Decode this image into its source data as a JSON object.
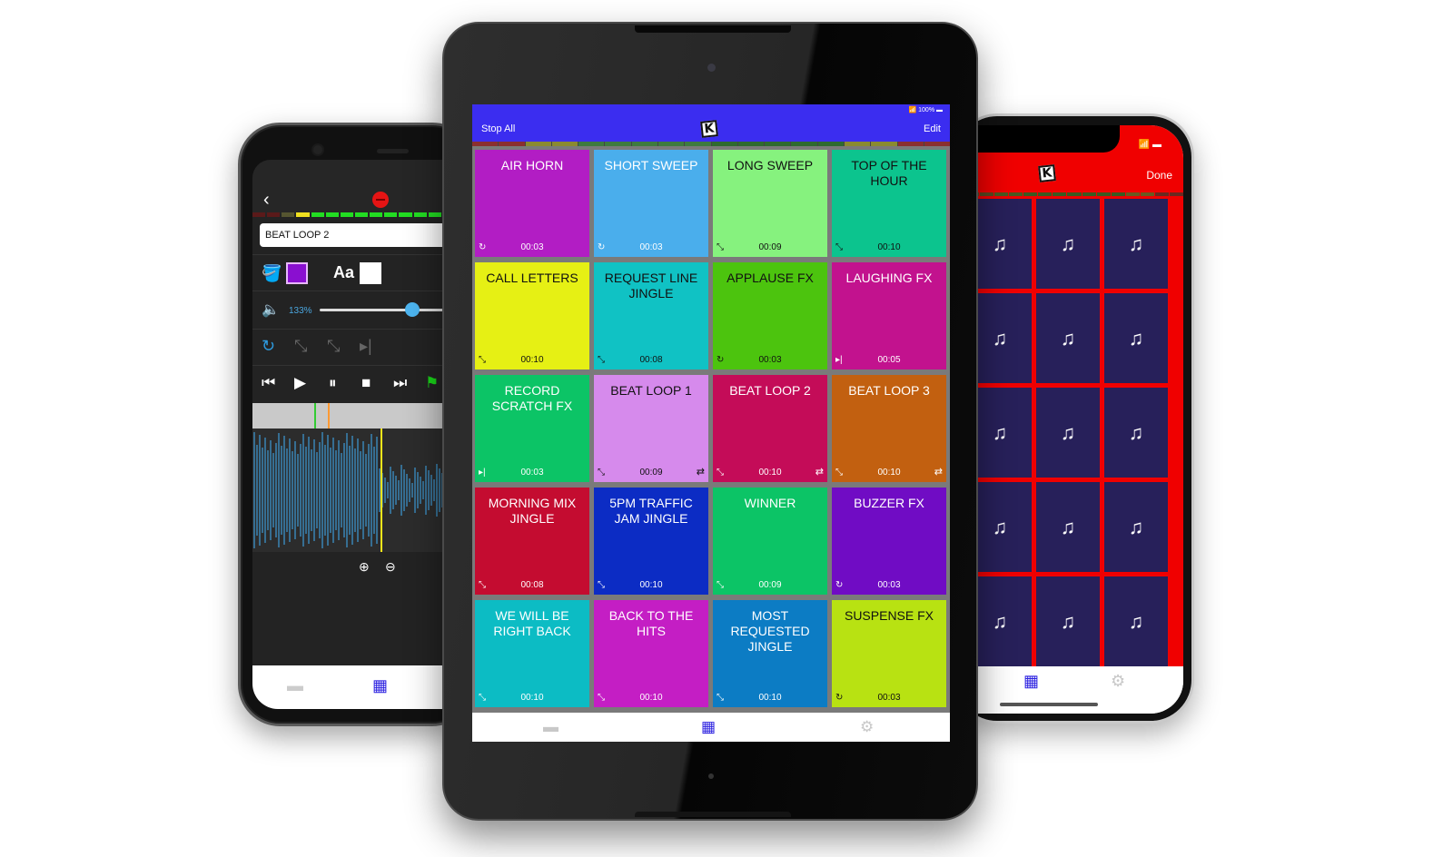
{
  "tablet": {
    "status_bar": {
      "wifi_icon": "wifi-icon",
      "battery_text": "100%"
    },
    "header": {
      "left_button": "Stop All",
      "right_button": "Edit",
      "logo_letter": "K",
      "background": "#3b2df0"
    },
    "level_meter_colors": [
      "#8a2f2f",
      "#8a2f2f",
      "#8a8a30",
      "#8a8a30",
      "#3e7a3e",
      "#3e7a3e",
      "#3e7a3e",
      "#3e7a3e",
      "#3e7a3e",
      "#2f6a2f",
      "#2f6a2f",
      "#2f6a2f",
      "#2f6a2f",
      "#2f6a2f",
      "#8a8a30",
      "#8a8a30",
      "#8a2f2f",
      "#8a2f2f"
    ],
    "pads": [
      {
        "title": "AIR HORN",
        "time": "00:03",
        "mode_icon": "restart-icon",
        "mode_glyph": "↻",
        "loop": false,
        "bg": "#b21dc4",
        "fg": "#ffffff"
      },
      {
        "title": "SHORT SWEEP",
        "time": "00:03",
        "mode_icon": "restart-icon",
        "mode_glyph": "↻",
        "loop": false,
        "bg": "#4aaeec",
        "fg": "#ffffff"
      },
      {
        "title": "LONG SWEEP",
        "time": "00:09",
        "mode_icon": "fade-icon",
        "mode_glyph": "⤡",
        "loop": false,
        "bg": "#86f27e",
        "fg": "#111111"
      },
      {
        "title": "TOP OF THE HOUR",
        "time": "00:10",
        "mode_icon": "fade-icon",
        "mode_glyph": "⤡",
        "loop": false,
        "bg": "#0cc48e",
        "fg": "#111111"
      },
      {
        "title": "CALL LETTERS",
        "time": "00:10",
        "mode_icon": "fade-icon",
        "mode_glyph": "⤡",
        "loop": false,
        "bg": "#e6f014",
        "fg": "#111111"
      },
      {
        "title": "REQUEST LINE JINGLE",
        "time": "00:08",
        "mode_icon": "fade-icon",
        "mode_glyph": "⤡",
        "loop": false,
        "bg": "#10c2c4",
        "fg": "#111111"
      },
      {
        "title": "APPLAUSE FX",
        "time": "00:03",
        "mode_icon": "restart-icon",
        "mode_glyph": "↻",
        "loop": false,
        "bg": "#4cc40e",
        "fg": "#111111"
      },
      {
        "title": "LAUGHING FX",
        "time": "00:05",
        "mode_icon": "play-to-end-icon",
        "mode_glyph": "▸|",
        "loop": false,
        "bg": "#c2128e",
        "fg": "#ffffff"
      },
      {
        "title": "RECORD SCRATCH FX",
        "time": "00:03",
        "mode_icon": "play-to-end-icon",
        "mode_glyph": "▸|",
        "loop": false,
        "bg": "#0cc466",
        "fg": "#ffffff"
      },
      {
        "title": "BEAT LOOP 1",
        "time": "00:09",
        "mode_icon": "fade-stop-icon",
        "mode_glyph": "⤡",
        "loop": true,
        "bg": "#d68aec",
        "fg": "#111111"
      },
      {
        "title": "BEAT LOOP 2",
        "time": "00:10",
        "mode_icon": "fade-stop-icon",
        "mode_glyph": "⤡",
        "loop": true,
        "bg": "#c40c58",
        "fg": "#ffffff"
      },
      {
        "title": "BEAT LOOP 3",
        "time": "00:10",
        "mode_icon": "fade-stop-icon",
        "mode_glyph": "⤡",
        "loop": true,
        "bg": "#c26010",
        "fg": "#ffffff"
      },
      {
        "title": "MORNING MIX JINGLE",
        "time": "00:08",
        "mode_icon": "fade-icon",
        "mode_glyph": "⤡",
        "loop": false,
        "bg": "#c40c30",
        "fg": "#ffffff"
      },
      {
        "title": "5PM TRAFFIC JAM JINGLE",
        "time": "00:10",
        "mode_icon": "fade-stop-icon",
        "mode_glyph": "⤡",
        "loop": false,
        "bg": "#0c2cc4",
        "fg": "#ffffff"
      },
      {
        "title": "WINNER",
        "time": "00:09",
        "mode_icon": "fade-icon",
        "mode_glyph": "⤡",
        "loop": false,
        "bg": "#0cc466",
        "fg": "#ffffff"
      },
      {
        "title": "BUZZER FX",
        "time": "00:03",
        "mode_icon": "restart-icon",
        "mode_glyph": "↻",
        "loop": false,
        "bg": "#700cc4",
        "fg": "#ffffff"
      },
      {
        "title": "WE WILL BE RIGHT BACK",
        "time": "00:10",
        "mode_icon": "fade-icon",
        "mode_glyph": "⤡",
        "loop": false,
        "bg": "#0cbcc4",
        "fg": "#ffffff"
      },
      {
        "title": "BACK TO THE HITS",
        "time": "00:10",
        "mode_icon": "fade-icon",
        "mode_glyph": "⤡",
        "loop": false,
        "bg": "#c41ec4",
        "fg": "#ffffff"
      },
      {
        "title": "MOST REQUESTED JINGLE",
        "time": "00:10",
        "mode_icon": "fade-icon",
        "mode_glyph": "⤡",
        "loop": false,
        "bg": "#0c7cc4",
        "fg": "#ffffff"
      },
      {
        "title": "SUSPENSE FX",
        "time": "00:03",
        "mode_icon": "restart-icon",
        "mode_glyph": "↻",
        "loop": false,
        "bg": "#b8e212",
        "fg": "#111111"
      }
    ],
    "loop_glyph": "⇄",
    "tabbar": {
      "folder_glyph": "▬",
      "grid_glyph": "▦",
      "settings_glyph": "⚙",
      "active_color": "#2a1fe0",
      "inactive_color": "#c8c8c8"
    }
  },
  "left_phone": {
    "back_glyph": "‹",
    "sound_name": "BEAT LOOP 2",
    "volume_percent": "133%",
    "volume_slider_fraction": 0.6,
    "background_color": "#8a0fd0",
    "text_color_label": "Aa",
    "mode_glyphs": [
      "↻",
      "⤡",
      "⤡",
      "▸|"
    ],
    "transport_glyphs": [
      "⏮",
      "▶",
      "⏸",
      "■",
      "⏭",
      "⚑"
    ],
    "zoom_in_glyph": "⊕",
    "zoom_out_glyph": "⊖",
    "meter_colors": [
      "#5a1a1a",
      "#5a1a1a",
      "#555530",
      "#f0e020",
      "#22dd22",
      "#22dd22",
      "#22dd22",
      "#22dd22",
      "#22dd22",
      "#22dd22",
      "#22dd22",
      "#22dd22",
      "#22dd22",
      "#22dd22",
      "#22dd22"
    ]
  },
  "right_phone": {
    "done_label": "Done",
    "logo_letter": "K",
    "add_sound_glyph": "♫",
    "empty_pad_count": 15,
    "header_color": "#f00000",
    "meter_colors": [
      "#5a4a20",
      "#5a4a20",
      "#4a5a20",
      "#4a5a20",
      "#3a5a20",
      "#3a5a20",
      "#3a5a20",
      "#3a5a20",
      "#3a5a20",
      "#3a5a20",
      "#3a5a20",
      "#6a5a20",
      "#6a5a20",
      "#6a2a20",
      "#6a2a20"
    ]
  }
}
